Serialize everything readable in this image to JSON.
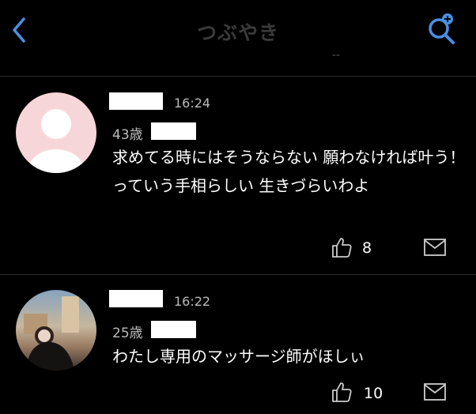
{
  "header": {
    "title": "つぶやき",
    "hint": "--"
  },
  "posts": [
    {
      "time": "16:24",
      "age": "43歳",
      "text": "求めてる時にはそうならない 願わなければ叶う！っていう手相らしい 生きづらいわよ",
      "likes": "8"
    },
    {
      "time": "16:22",
      "age": "25歳",
      "text": "わたし専用のマッサージ師がほしぃ",
      "likes": "10"
    }
  ],
  "colors": {
    "accent": "#4a90e2",
    "background": "#000000",
    "default_avatar": "#f7d6d9"
  }
}
